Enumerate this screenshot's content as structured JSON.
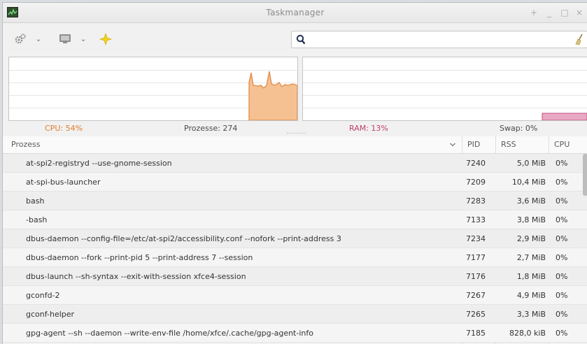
{
  "window": {
    "title": "Taskmanager",
    "buttons": {
      "pin": "+",
      "minimize": "_",
      "maximize": "□",
      "close": "×"
    }
  },
  "toolbar": {
    "settings_dropdown_arrow": "⌄",
    "view_dropdown_arrow": "⌄",
    "search": {
      "value": "",
      "placeholder": ""
    }
  },
  "icons": {
    "app": "taskmanager-icon",
    "settings": "gears-icon",
    "view": "monitor-icon",
    "target": "crosshair-icon",
    "search": "search-icon",
    "clear": "clear-icon",
    "sort": "chevron-down-icon"
  },
  "colors": {
    "cpu": "#f0a060",
    "cpu_text": "#e07c2a",
    "ram": "#e8a0bc",
    "ram_text": "#c0406a"
  },
  "stats": {
    "cpu": "CPU: 54%",
    "processes": "Prozesse: 274",
    "ram": "RAM: 13%",
    "swap": "Swap: 0%"
  },
  "graphs": {
    "cpu_percent": 54,
    "ram_percent": 13
  },
  "table": {
    "columns": {
      "name": "Prozess",
      "pid": "PID",
      "rss": "RSS",
      "cpu": "CPU"
    },
    "rows": [
      {
        "name": "at-spi2-registryd --use-gnome-session",
        "pid": "7240",
        "rss": "5,0 MiB",
        "cpu": "0%"
      },
      {
        "name": "at-spi-bus-launcher",
        "pid": "7209",
        "rss": "10,4 MiB",
        "cpu": "0%"
      },
      {
        "name": "bash",
        "pid": "7283",
        "rss": "3,6 MiB",
        "cpu": "0%"
      },
      {
        "name": "-bash",
        "pid": "7133",
        "rss": "3,8 MiB",
        "cpu": "0%"
      },
      {
        "name": "dbus-daemon --config-file=/etc/at-spi2/accessibility.conf --nofork --print-address 3",
        "pid": "7234",
        "rss": "2,9 MiB",
        "cpu": "0%"
      },
      {
        "name": "dbus-daemon --fork --print-pid 5 --print-address 7 --session",
        "pid": "7177",
        "rss": "2,7 MiB",
        "cpu": "0%"
      },
      {
        "name": "dbus-launch --sh-syntax --exit-with-session xfce4-session",
        "pid": "7176",
        "rss": "1,8 MiB",
        "cpu": "0%"
      },
      {
        "name": "gconfd-2",
        "pid": "7267",
        "rss": "4,9 MiB",
        "cpu": "0%"
      },
      {
        "name": "gconf-helper",
        "pid": "7265",
        "rss": "3,3 MiB",
        "cpu": "0%"
      },
      {
        "name": "gpg-agent --sh --daemon --write-env-file /home/xfce/.cache/gpg-agent-info",
        "pid": "7185",
        "rss": "828,0 kiB",
        "cpu": "0%"
      }
    ]
  }
}
